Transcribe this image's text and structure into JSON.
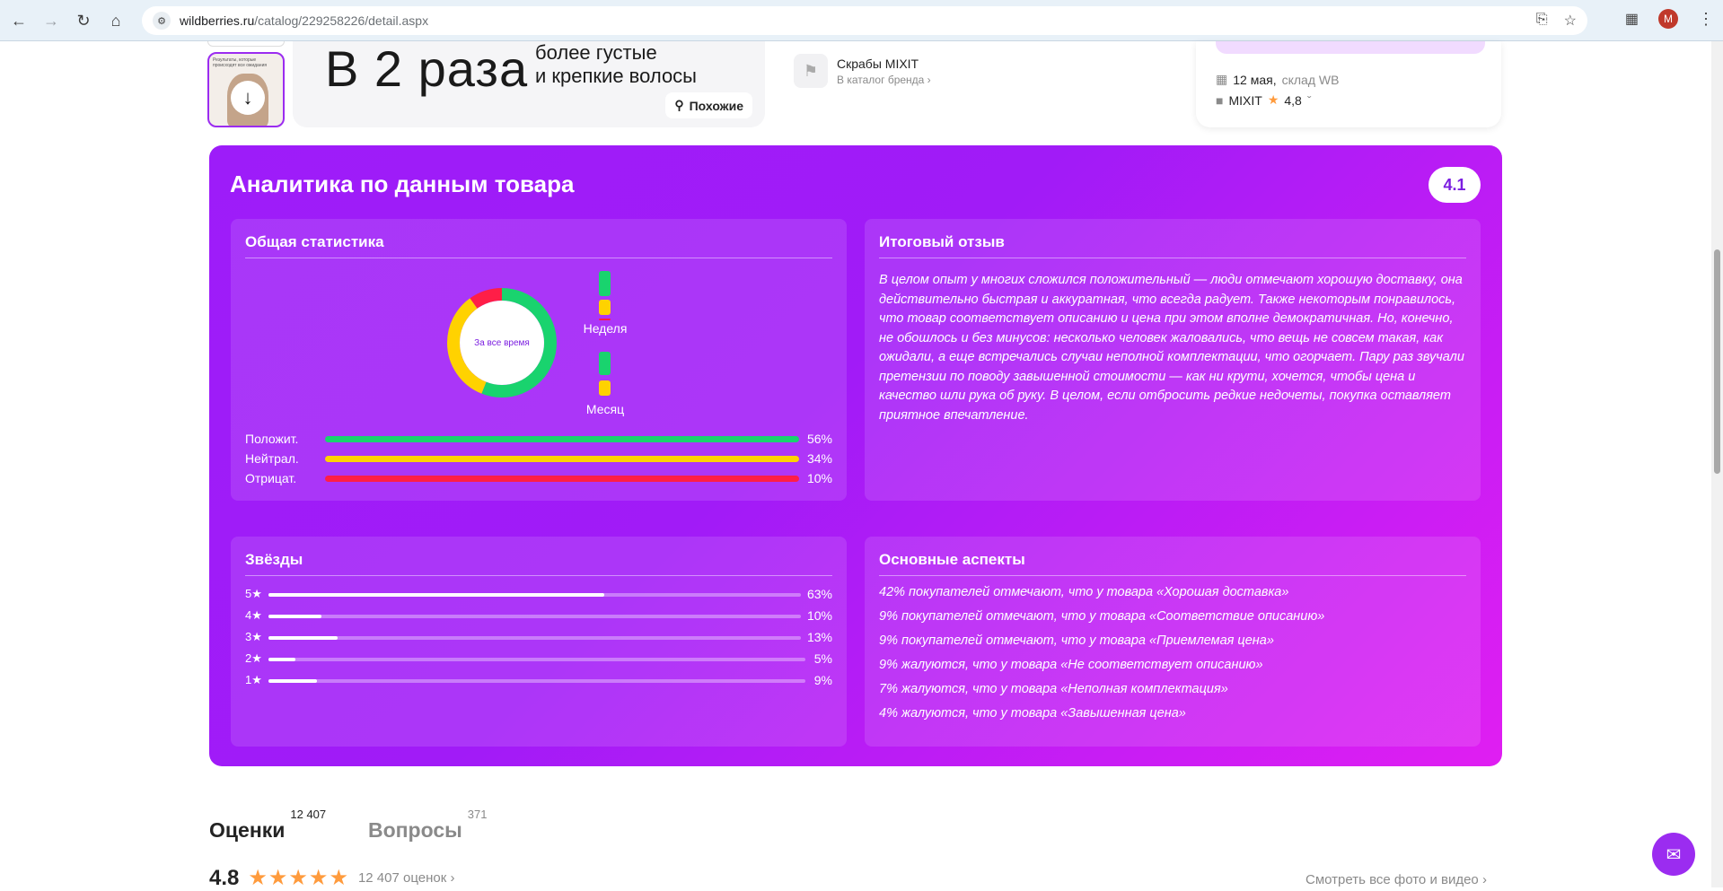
{
  "browser": {
    "url_host": "wildberries.ru",
    "url_path": "/catalog/229258226/detail.aspx",
    "avatar_letter": "M"
  },
  "product_strip": {
    "banner_big": "В 2 раза",
    "banner_small_1": "более густые",
    "banner_small_2": "и крепкие волосы",
    "similar_label": "Похожие",
    "thumb_caption": "Результаты, которые происходят все ожидания",
    "brand_name": "Скрабы MIXIT",
    "brand_link": "В каталог бренда",
    "delivery_date": "12 мая,",
    "delivery_warehouse": "склад WB",
    "seller_name": "MIXIT",
    "seller_rating": "4,8"
  },
  "analytics": {
    "title": "Аналитика по данным товара",
    "score": "4.1",
    "general": {
      "title": "Общая статистика",
      "donut_label": "За все время",
      "week_label": "Неделя",
      "month_label": "Месяц",
      "rows": [
        {
          "label": "Положит.",
          "pct": "56%",
          "value": 56,
          "color": "#19d36e"
        },
        {
          "label": "Нейтрал.",
          "pct": "34%",
          "value": 34,
          "color": "#ffd200"
        },
        {
          "label": "Отрицат.",
          "pct": "10%",
          "value": 10,
          "color": "#ff1e47"
        }
      ]
    },
    "summary": {
      "title": "Итоговый отзыв",
      "text": "В целом опыт у многих сложился положительный — люди отмечают хорошую доставку, она действительно быстрая и аккуратная, что всегда радует. Также некоторым понравилось, что товар соответствует описанию и цена при этом вполне демократичная. Но, конечно, не обошлось и без минусов: несколько человек жаловались, что вещь не совсем такая, как ожидали, а еще встречались случаи неполной комплектации, что огорчает. Пару раз звучали претензии по поводу завышенной стоимости — как ни крути, хочется, чтобы цена и качество шли рука об руку. В целом, если отбросить редкие недочеты, покупка оставляет приятное впечатление."
    },
    "stars": {
      "title": "Звёзды",
      "rows": [
        {
          "label": "5★",
          "pct": "63%",
          "value": 63
        },
        {
          "label": "4★",
          "pct": "10%",
          "value": 10
        },
        {
          "label": "3★",
          "pct": "13%",
          "value": 13
        },
        {
          "label": "2★",
          "pct": "5%",
          "value": 5
        },
        {
          "label": "1★",
          "pct": "9%",
          "value": 9
        }
      ]
    },
    "aspects": {
      "title": "Основные аспекты",
      "items": [
        "42% покупателей отмечают, что у товара «Хорошая доставка»",
        "9% покупателей отмечают, что у товара «Соответствие описанию»",
        "9% покупателей отмечают, что у товара «Приемлемая цена»",
        "9% жалуются, что у товара «Не соответствует описанию»",
        "7% жалуются, что у товара «Неполная комплектация»",
        "4% жалуются, что у товара «Завышенная цена»"
      ]
    }
  },
  "reviews": {
    "tab_ratings": "Оценки",
    "tab_ratings_count": "12 407",
    "tab_questions": "Вопросы",
    "tab_questions_count": "371",
    "rating_value": "4.8",
    "rating_count": "12 407 оценок",
    "see_all": "Смотреть все фото и видео"
  }
}
